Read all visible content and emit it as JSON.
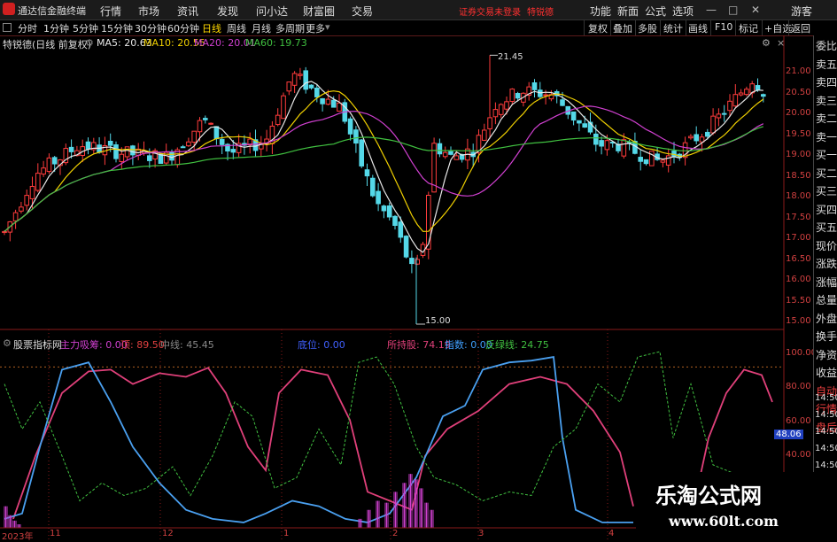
{
  "app": {
    "name": "通达信金融终端"
  },
  "menu": [
    "行情",
    "市场",
    "资讯",
    "发现",
    "问小达",
    "财富圈",
    "交易"
  ],
  "notice": {
    "text": "证券交易未登录",
    "stock": "特锐德"
  },
  "right_menu": [
    "功能",
    "新面",
    "公式",
    "选项"
  ],
  "guest_label": "游客",
  "window_controls": [
    "—",
    "□",
    "✕"
  ],
  "periods": [
    "分时",
    "1分钟",
    "5分钟",
    "15分钟",
    "30分钟",
    "60分钟",
    "日线",
    "周线",
    "月线",
    "多周期",
    "更多"
  ],
  "selected_period": "日线",
  "tools": [
    "复权",
    "叠加",
    "多股",
    "统计",
    "画线",
    "F10",
    "标记",
    "+自选",
    "返回"
  ],
  "header": {
    "stock_title": "特锐德(日线 前复权)",
    "ma": [
      {
        "label": "MA5: 20.63",
        "color": "#e8e8e8"
      },
      {
        "label": "MA10: 20.55",
        "color": "#f0d000"
      },
      {
        "label": "MA20: 20.01",
        "color": "#d040d0"
      },
      {
        "label": "MA60: 19.73",
        "color": "#40c040"
      }
    ]
  },
  "sidebar": [
    "委比",
    "卖五",
    "卖四",
    "卖三",
    "卖二",
    "卖一",
    "买一",
    "买二",
    "买三",
    "买四",
    "买五",
    "现价",
    "涨跌",
    "涨幅",
    "总量",
    "外盘",
    "换手",
    "净资",
    "收益",
    "自动",
    "行情",
    "盘后"
  ],
  "price_axis": [
    "21.00",
    "20.50",
    "20.00",
    "19.50",
    "19.00",
    "18.50",
    "18.00",
    "17.50",
    "17.00",
    "16.50",
    "16.00",
    "15.50",
    "15.00"
  ],
  "annotations": {
    "high": "21.45",
    "low": "15.00"
  },
  "indicator": {
    "name": "股票指标网",
    "labels": [
      {
        "text": "主力吸筹: 0.00",
        "color": "#d040d0"
      },
      {
        "text": "顶: 89.50",
        "color": "#e04040"
      },
      {
        "text": "中线: 45.45",
        "color": "#888888"
      },
      {
        "text": "底位: 0.00",
        "color": "#4060ff"
      },
      {
        "text": "所持股: 74.19",
        "color": "#e0407a"
      },
      {
        "text": "指数: 0.00",
        "color": "#40a0ff"
      },
      {
        "text": "反绿线: 24.75",
        "color": "#40c040"
      }
    ],
    "axis": [
      "100.00",
      "80.00",
      "60.00",
      "40.00"
    ],
    "current": "48.06",
    "times": [
      "14:50",
      "14:50",
      "14:50",
      "14:50",
      "14:50"
    ]
  },
  "x_axis": [
    "2023年",
    "11",
    "12",
    "1",
    "2",
    "3",
    "4"
  ],
  "watermark": {
    "title": "乐淘公式网",
    "url": "www.60lt.com"
  },
  "chart_data": {
    "type": "candlestick",
    "price_range": [
      14.8,
      21.9
    ],
    "indicator_range": [
      0,
      105
    ]
  }
}
